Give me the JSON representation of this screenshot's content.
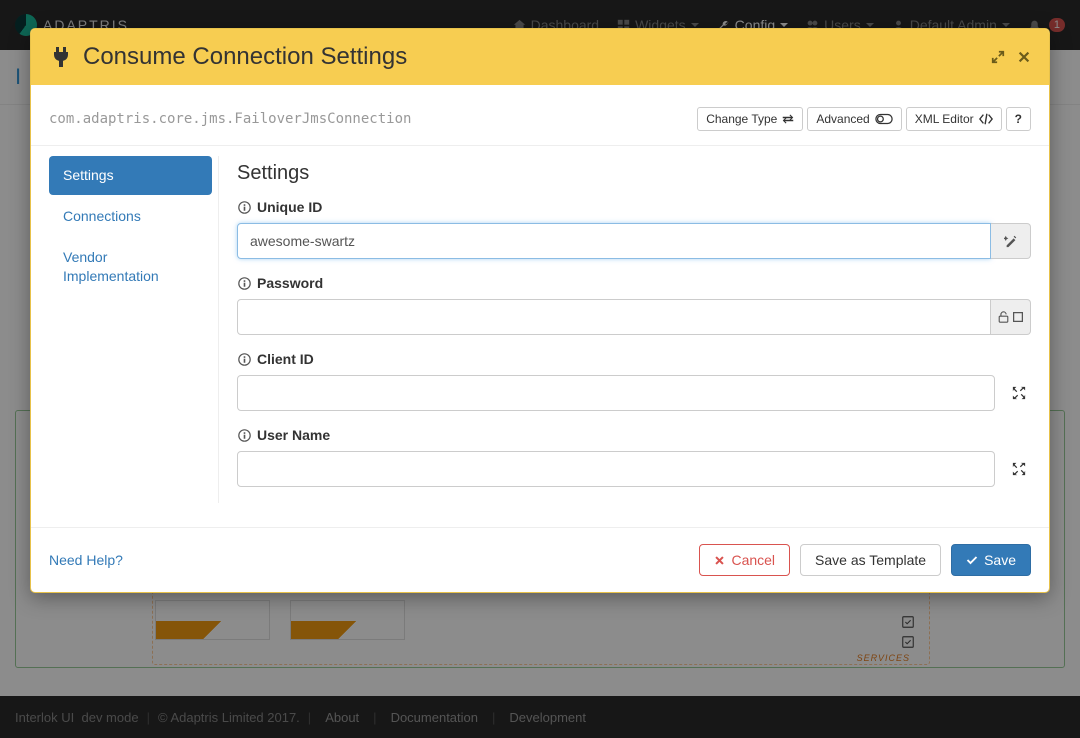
{
  "nav": {
    "brand": "ADAPTRIS",
    "items": {
      "dashboard": "Dashboard",
      "widgets": "Widgets",
      "config": "Config",
      "users": "Users",
      "user": "Default Admin"
    },
    "notification_count": "1"
  },
  "page": {
    "title_prefix": "I"
  },
  "modal": {
    "title": "Consume Connection Settings",
    "classname": "com.adaptris.core.jms.FailoverJmsConnection",
    "toolbar": {
      "change_type": "Change Type",
      "advanced": "Advanced",
      "xml_editor": "XML Editor",
      "help": "?"
    },
    "sidebar": {
      "settings": "Settings",
      "connections": "Connections",
      "vendor": "Vendor Implementation"
    },
    "form": {
      "heading": "Settings",
      "unique_id_label": "Unique ID",
      "unique_id_value": "awesome-swartz",
      "password_label": "Password",
      "password_value": "",
      "client_id_label": "Client ID",
      "client_id_value": "",
      "user_name_label": "User Name",
      "user_name_value": ""
    },
    "footer": {
      "help": "Need Help?",
      "cancel": "Cancel",
      "save_template": "Save as Template",
      "save": "Save"
    }
  },
  "bg": {
    "services": "SERVICES"
  },
  "footer": {
    "app": "Interlok UI",
    "mode": "dev mode",
    "copyright": "© Adaptris Limited 2017.",
    "about": "About",
    "docs": "Documentation",
    "dev": "Development"
  }
}
